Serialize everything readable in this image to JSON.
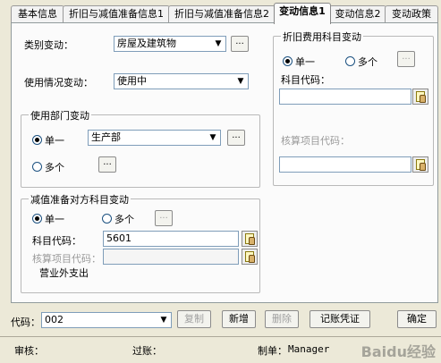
{
  "tabs": [
    "基本信息",
    "折旧与减值准备信息1",
    "折旧与减值准备信息2",
    "变动信息1",
    "变动信息2",
    "变动政策"
  ],
  "category_change": {
    "label": "类别变动：",
    "value": "房屋及建筑物",
    "more": "..."
  },
  "usage_change": {
    "label": "使用情况变动：",
    "value": "使用中"
  },
  "dept_change": {
    "title": "使用部门变动",
    "single_label": "单一",
    "multi_label": "多个",
    "value": "生产部",
    "more": "...",
    "multi_more": "..."
  },
  "impairment_account": {
    "title": "减值准备对方科目变动",
    "single_label": "单一",
    "multi_label": "多个",
    "multi_more": "...",
    "account_code_label": "科目代码：",
    "account_code_value": "5601",
    "project_code_label": "核算项目代码：",
    "project_code_value": "",
    "account_name": "营业外支出"
  },
  "depreciation_account": {
    "title": "折旧费用科目变动",
    "single_label": "单一",
    "multi_label": "多个",
    "multi_more": "...",
    "account_code_label": "科目代码：",
    "account_code_value": "",
    "project_code_label": "核算项目代码：",
    "project_code_value": ""
  },
  "bottom": {
    "code_label": "代码：",
    "code_value": "002",
    "buttons": {
      "copy": "复制",
      "add": "新增",
      "delete": "删除",
      "voucher": "记账凭证",
      "confirm": "确定"
    }
  },
  "status": {
    "audit_label": "审核：",
    "posted_label": "过账：",
    "creator_label": "制单：",
    "creator_value": "Manager"
  },
  "watermark": "Baidu经验"
}
